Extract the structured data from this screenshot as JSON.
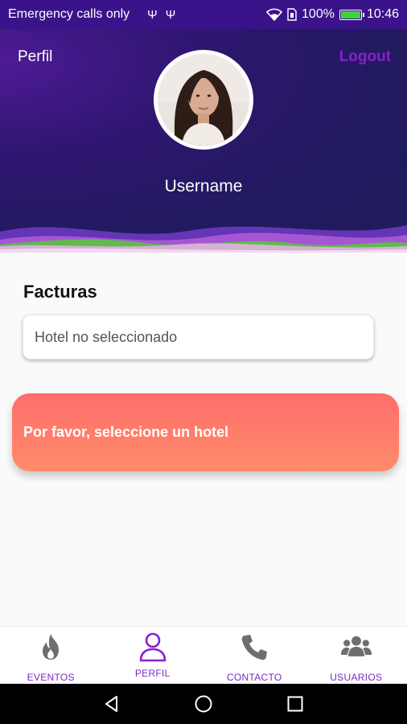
{
  "status_bar": {
    "carrier": "Emergency calls only",
    "usb_icons": [
      "Ψ",
      "Ψ"
    ],
    "battery_percent": "100%",
    "time": "10:46"
  },
  "header": {
    "left_label": "Perfil",
    "logout_label": "Logout",
    "username": "Username"
  },
  "main": {
    "section_title": "Facturas",
    "hotel_select_value": "Hotel no seleccionado",
    "alert_text": "Por favor, seleccione un hotel"
  },
  "bottom_nav": {
    "items": [
      {
        "label": "EVENTOS",
        "icon": "flame-icon",
        "active": false
      },
      {
        "label": "PERFIL",
        "icon": "person-icon",
        "active": true
      },
      {
        "label": "CONTACTO",
        "icon": "phone-icon",
        "active": false
      },
      {
        "label": "USUARIOS",
        "icon": "users-icon",
        "active": false
      }
    ]
  },
  "colors": {
    "status_bar": "#3a138a",
    "header_dark": "#211a5e",
    "accent_purple": "#8a1fd0",
    "alert_start": "#ff6d6b",
    "alert_end": "#ff8c6a",
    "nav_icon_gray": "#6e6e6e"
  }
}
